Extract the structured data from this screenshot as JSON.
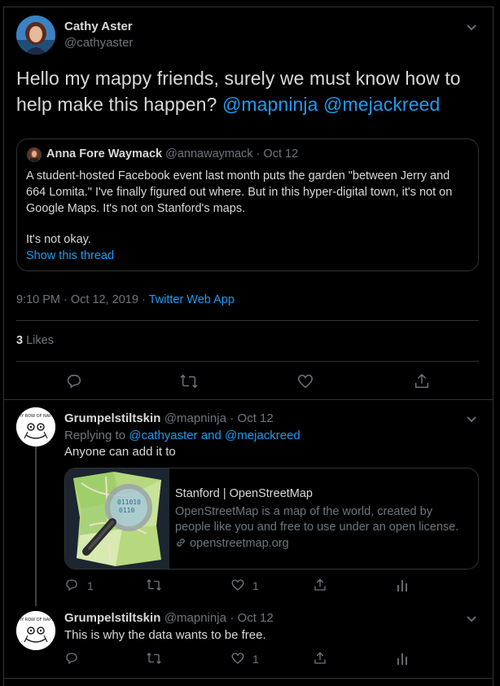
{
  "tweet": {
    "author_name": "Cathy Aster",
    "author_handle": "@cathyaster",
    "text_prefix": "Hello my mappy friends, surely we must know how to help make this happen?",
    "mention_1": "@mapninja",
    "mention_2": "@mejackreed",
    "time": "9:10 PM · Oct 12, 2019",
    "dot": "·",
    "source": "Twitter Web App",
    "likes_count": "3",
    "likes_label": "Likes"
  },
  "quote": {
    "author_name": "Anna Fore Waymack",
    "author_handle": "@annawaymack",
    "date": "· Oct 12",
    "line_1": "A student-hosted Facebook event last month puts the garden \"between Jerry and",
    "line_2": "664 Lomita.\" I've finally figured out where. But in this hyper-digital town, it's not on",
    "line_3": "Google Maps. It's not on Stanford's maps.",
    "line_4": "It's not okay.",
    "show_thread": "Show this thread"
  },
  "reply_1": {
    "author_name": "Grumpelstiltskin",
    "author_handle": "@mapninja",
    "date": "· Oct 12",
    "replying_to_label": "Replying to",
    "replying_to_users": "@cathyaster and @mejackreed",
    "text": "Anyone can add it to",
    "reply_count": "1",
    "like_count": "1"
  },
  "link_card": {
    "title": "Stanford | OpenStreetMap",
    "description_1": "OpenStreetMap is a map of the world, created by",
    "description_2": "people like you and free to use under an open license.",
    "domain": "openstreetmap.org"
  },
  "reply_2": {
    "author_name": "Grumpelstiltskin",
    "author_handle": "@mapninja",
    "date": "· Oct 12",
    "text": "This is why the data wants to be free.",
    "like_count": "1"
  },
  "colors": {
    "background": "#000000",
    "text": "#d9d9d9",
    "muted": "#6e767d",
    "link": "#1d9bf0",
    "border": "#2f3336"
  },
  "icons": [
    "chevron-down-icon",
    "reply-icon",
    "retweet-icon",
    "like-icon",
    "share-icon",
    "analytics-icon",
    "link-icon",
    "osm-logo"
  ]
}
